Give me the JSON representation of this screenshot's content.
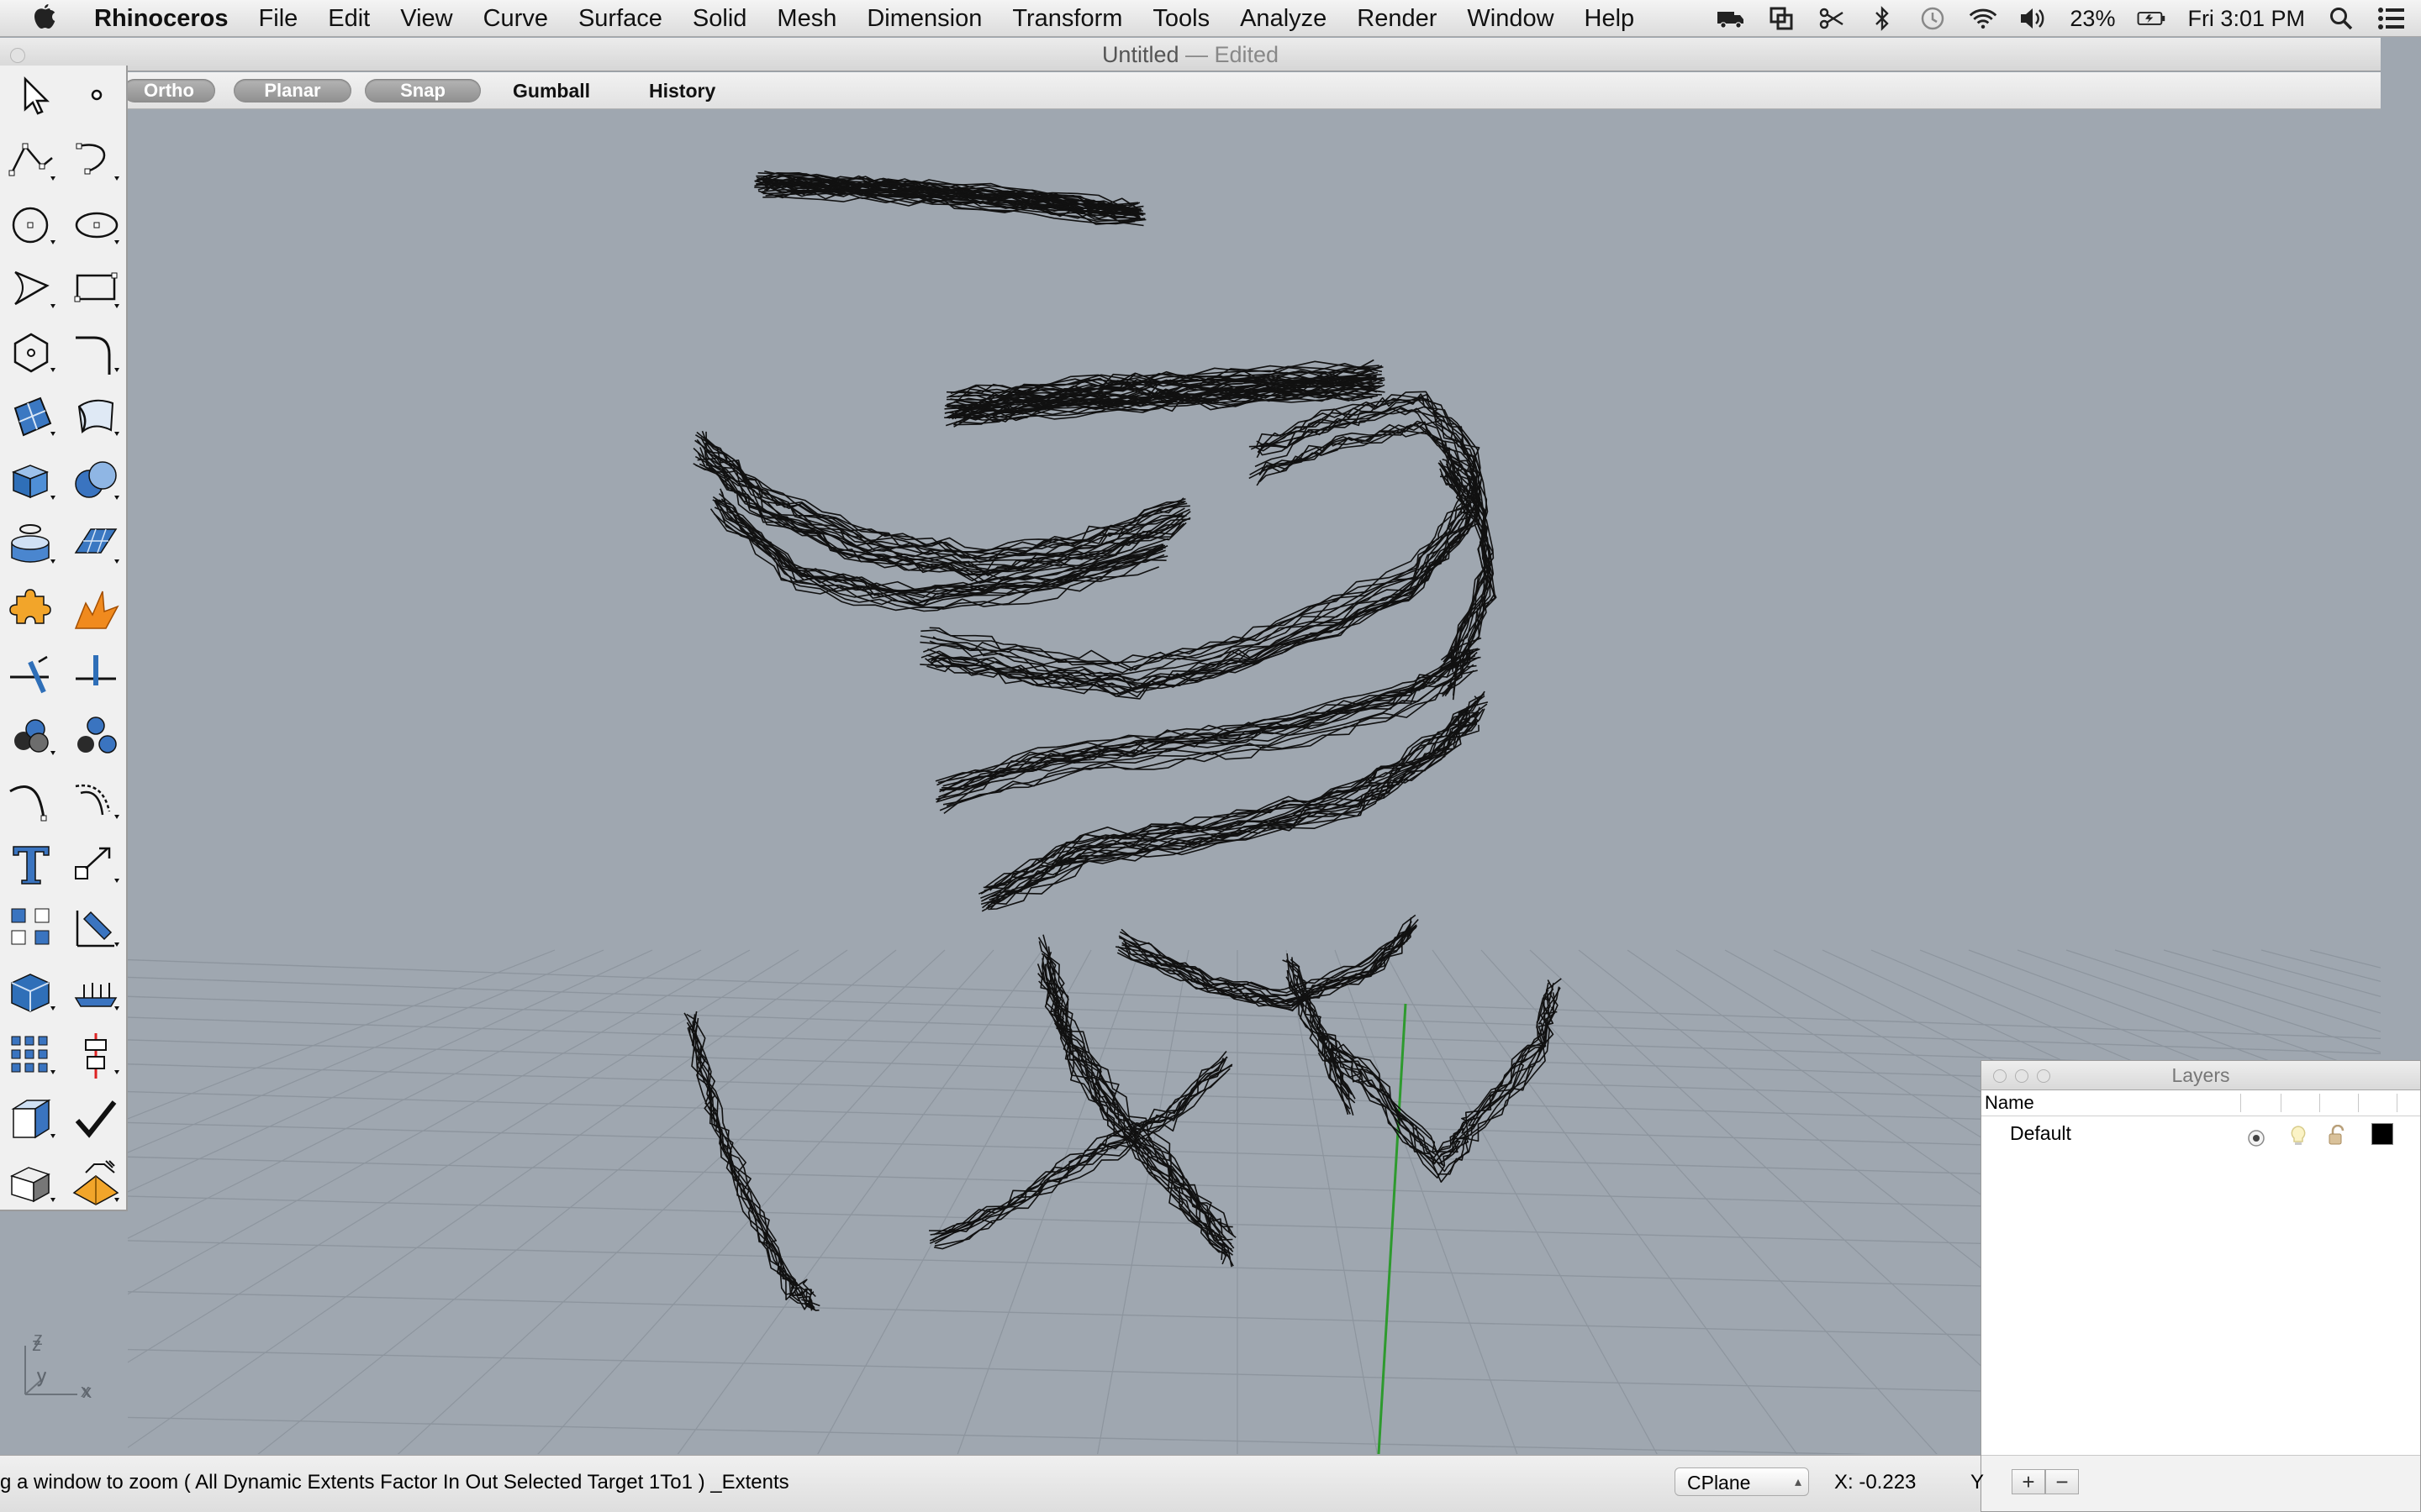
{
  "menubar": {
    "app_name": "Rhinoceros",
    "items": [
      "File",
      "Edit",
      "View",
      "Curve",
      "Surface",
      "Solid",
      "Mesh",
      "Dimension",
      "Transform",
      "Tools",
      "Analyze",
      "Render",
      "Window",
      "Help"
    ],
    "battery": "23%",
    "clock": "Fri 3:01 PM"
  },
  "window": {
    "title": "Untitled",
    "edited": "— Edited"
  },
  "modebar": {
    "ortho": "Ortho",
    "planar": "Planar",
    "snap": "Snap",
    "gumball": "Gumball",
    "history": "History"
  },
  "viewport": {
    "axis_z": "z",
    "axis_y": "y",
    "axis_x": "x"
  },
  "layers": {
    "title": "Layers",
    "column_name": "Name",
    "rows": [
      {
        "name": "Default",
        "color": "#000000"
      }
    ],
    "add": "+",
    "remove": "−"
  },
  "status": {
    "command_prompt": "g a window to zoom ( All Dynamic Extents Factor In Out Selected Target 1To1 ) _Extents",
    "cplane": "CPlane",
    "coord_x": "X: -0.223",
    "coord_y": "Y"
  },
  "colors": {
    "viewport_bg": "#9fa7b0",
    "grid_line": "#8d959e",
    "y_axis": "#2e9a2e",
    "mesh": "#111111"
  }
}
